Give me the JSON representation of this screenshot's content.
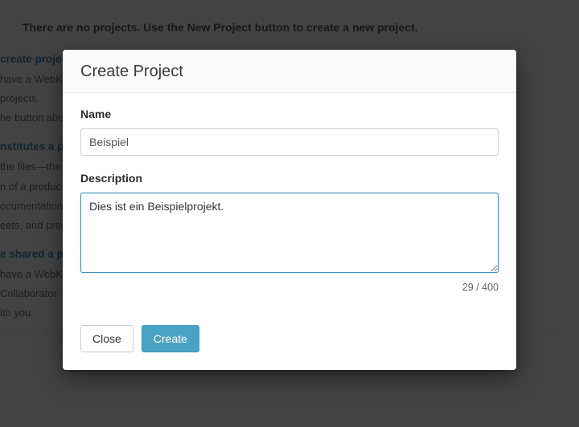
{
  "background": {
    "banner": "There are no projects. Use the New Project button to create a new project.",
    "q1": "create projects?",
    "p1a": "have a WebK",
    "p1b": "projects.",
    "p1c": "he button abo",
    "q2": "nstitutes a pr",
    "p2a": "the files—the",
    "p2b": "n of a produc",
    "p2c": "ocumentation",
    "p2d": "eets, and pres",
    "q3": "e shared a pr",
    "p3a": "have a WebK",
    "p3b": "Collaborator",
    "p3c": "ith you."
  },
  "modal": {
    "title": "Create Project",
    "name_label": "Name",
    "name_value": "Beispiel",
    "description_label": "Description",
    "description_value": "Dies ist ein Beispielprojekt.",
    "counter": "29 / 400",
    "close_label": "Close",
    "create_label": "Create"
  }
}
